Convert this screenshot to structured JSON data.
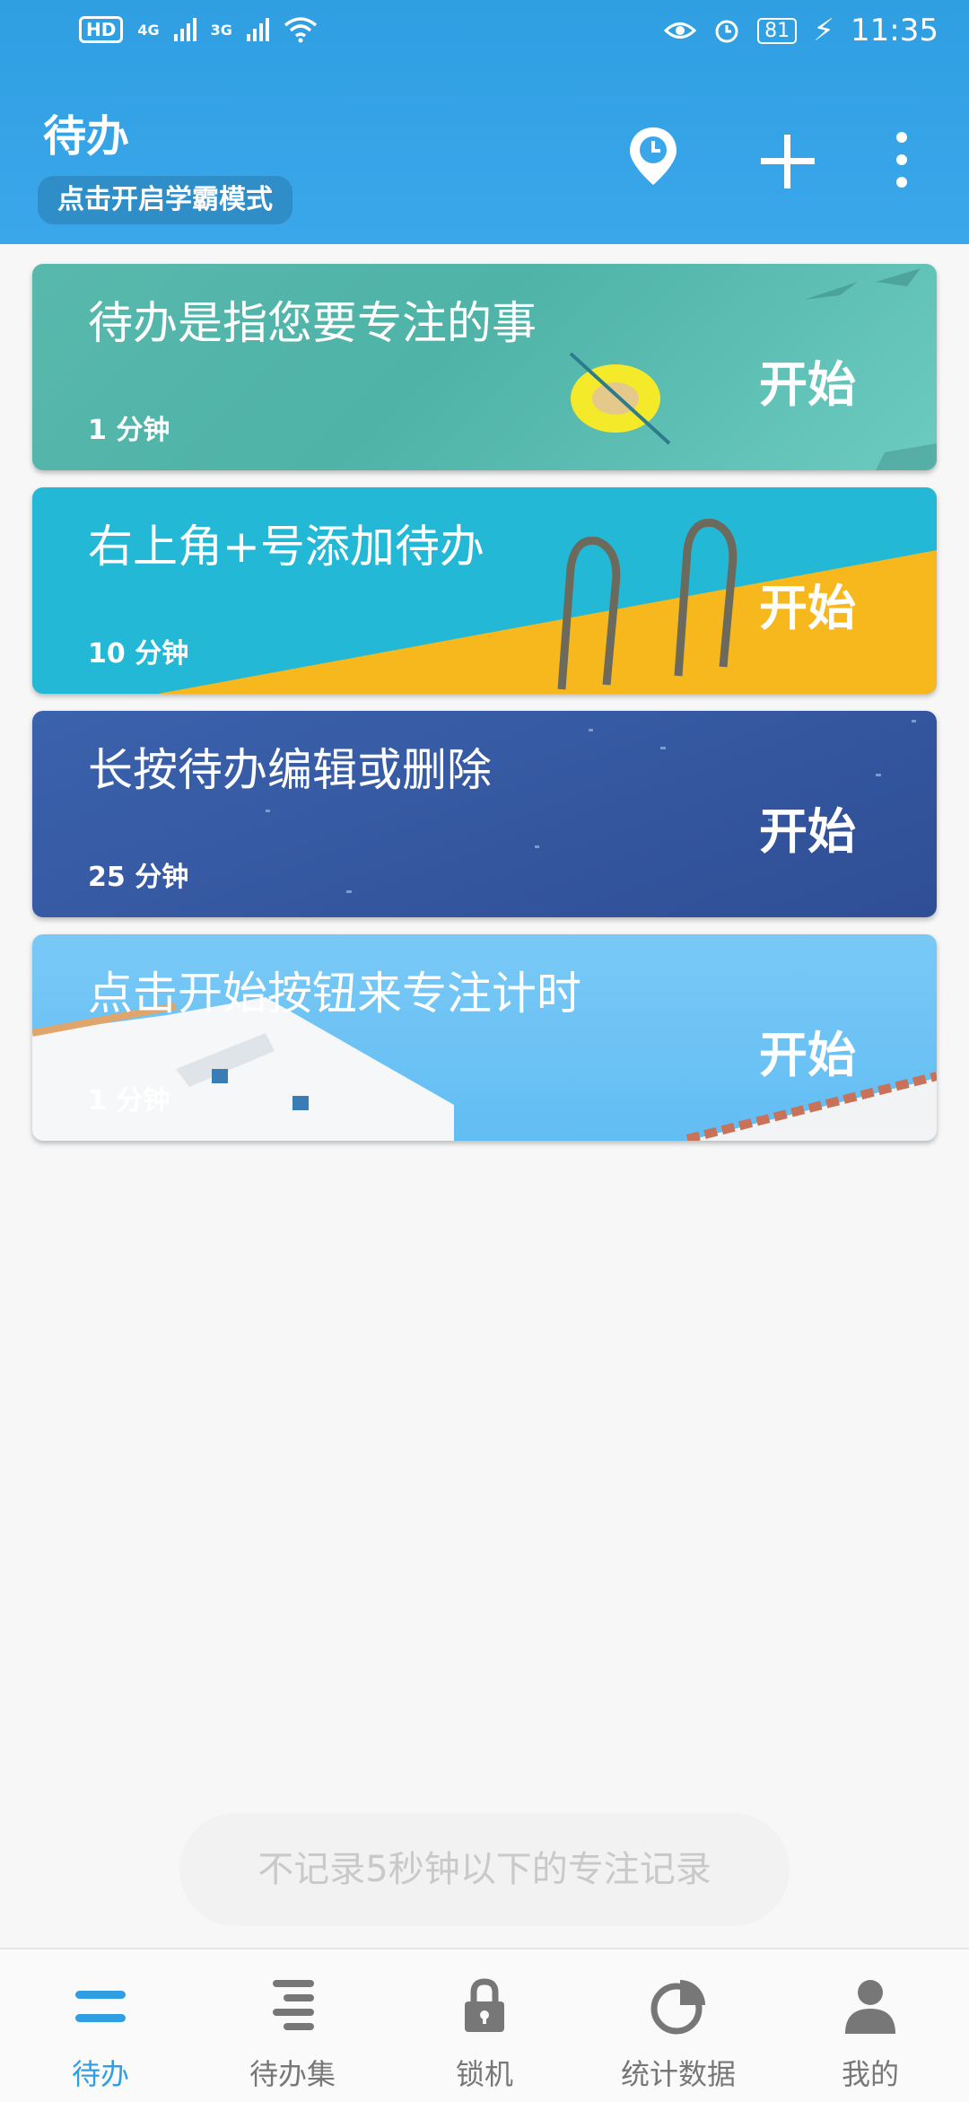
{
  "statusbar": {
    "hd": "HD",
    "net1": "4G",
    "net2": "3G",
    "battery": "81",
    "time": "11:35"
  },
  "header": {
    "title": "待办",
    "mode_button": "点击开启学霸模式"
  },
  "todos": [
    {
      "title": "待办是指您要专注的事",
      "duration": "1 分钟",
      "start": "开始"
    },
    {
      "title": "右上角+号添加待办",
      "duration": "10 分钟",
      "start": "开始"
    },
    {
      "title": "长按待办编辑或删除",
      "duration": "25 分钟",
      "start": "开始"
    },
    {
      "title": "点击开始按钮来专注计时",
      "duration": "1 分钟",
      "start": "开始"
    }
  ],
  "toast": "不记录5秒钟以下的专注记录",
  "nav": [
    {
      "label": "待办",
      "icon": "todo-icon",
      "active": true
    },
    {
      "label": "待办集",
      "icon": "todo-set-icon"
    },
    {
      "label": "锁机",
      "icon": "lock-icon"
    },
    {
      "label": "统计数据",
      "icon": "pie-chart-icon"
    },
    {
      "label": "我的",
      "icon": "person-icon"
    }
  ],
  "colors": {
    "primary": "#2f9fe2",
    "card1": "#5cbcb0",
    "card2": "#22b8d6",
    "card3": "#3559a3",
    "card4": "#6ec6f7"
  }
}
